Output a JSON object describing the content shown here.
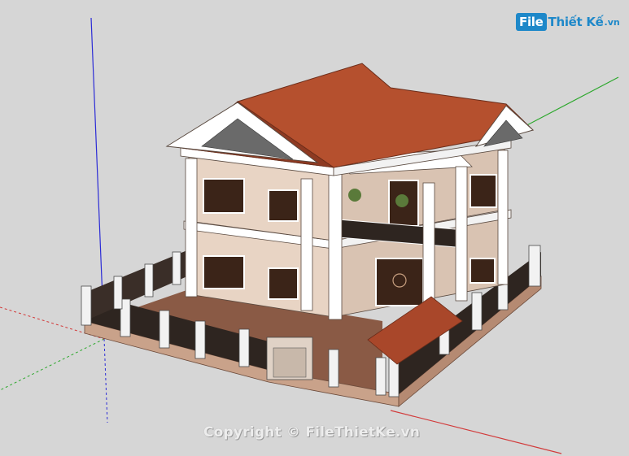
{
  "scene": {
    "subject": "3D model of a two-storey villa with red tile roof and surrounding fence",
    "colors": {
      "background": "#d6d6d6",
      "roof": "#b5502e",
      "roof_dark": "#8e3a22",
      "wall": "#e8d4c4",
      "trim": "#ffffff",
      "window": "#3b2418",
      "floor": "#8a5a45",
      "fence_base": "#c9a28a",
      "axis_red": "#d23b3b",
      "axis_green": "#2ea82e",
      "axis_blue": "#2b2bd6"
    }
  },
  "logo": {
    "file": "File",
    "thietke": "Thiết Kế",
    "domain": ".vn"
  },
  "watermark": "Copyright © FileThietKe.vn"
}
